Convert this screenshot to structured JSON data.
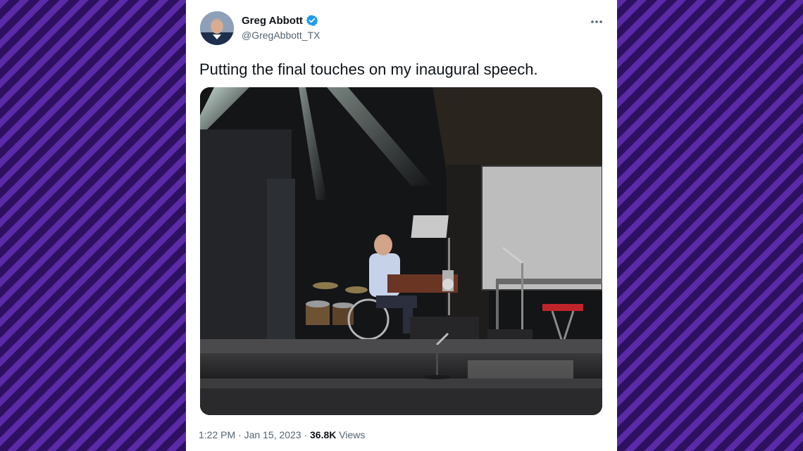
{
  "tweet": {
    "author": {
      "name": "Greg Abbott",
      "handle": "@GregAbbott_TX",
      "verified": true
    },
    "text": "Putting the final touches on my inaugural speech.",
    "time": "1:22 PM",
    "separator": "·",
    "date": "Jan 15, 2023",
    "views_count": "36.8K",
    "views_label": "Views"
  },
  "icons": {
    "more": "more-options-icon",
    "verified": "verified-badge-icon"
  },
  "colors": {
    "verified_blue": "#1d9bf0",
    "text_primary": "#0f1419",
    "text_secondary": "#536471",
    "background_stripe_light": "#5a2aa8",
    "background_stripe_dark": "#2d1160"
  }
}
